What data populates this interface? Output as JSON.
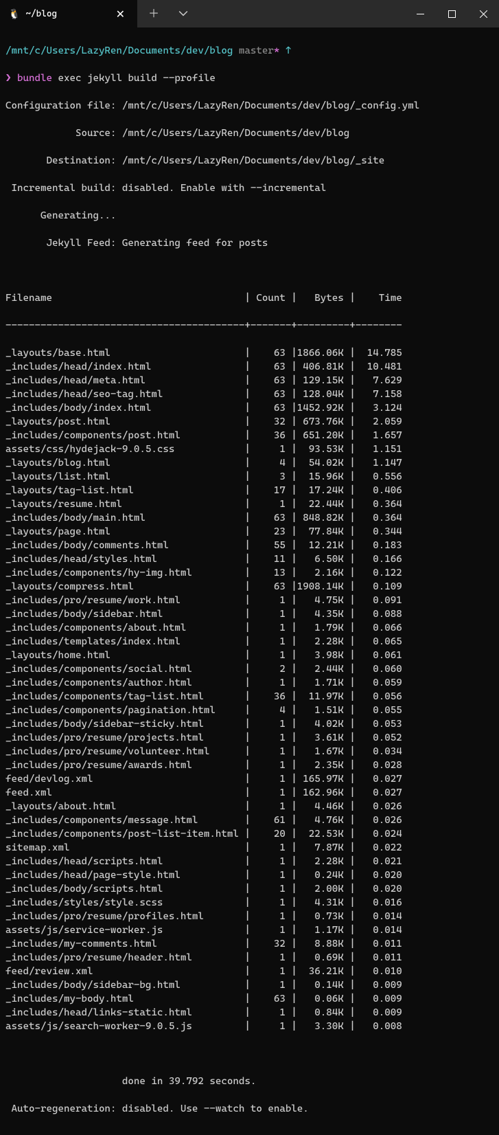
{
  "tab": {
    "title": "~/blog",
    "icon": "🐧"
  },
  "prompt": {
    "path": "/mnt/c/Users/LazyRen/Documents/dev/blog",
    "branch": "master",
    "dirty": "*",
    "ahead": "↑",
    "symbol": "❯",
    "command": "bundle",
    "args": "exec jekyll build --profile"
  },
  "output": {
    "config_line": "Configuration file: /mnt/c/Users/LazyRen/Documents/dev/blog/_config.yml",
    "source_line": "            Source: /mnt/c/Users/LazyRen/Documents/dev/blog",
    "dest_line": "       Destination: /mnt/c/Users/LazyRen/Documents/dev/blog/_site",
    "incremental_line": " Incremental build: disabled. Enable with --incremental",
    "generating_line": "      Generating...",
    "feed_line": "       Jekyll Feed: Generating feed for posts",
    "done_line": "                    done in 39.792 seconds.",
    "autoregen_line": " Auto-regeneration: disabled. Use --watch to enable."
  },
  "table": {
    "header": {
      "filename": "Filename",
      "count": "Count",
      "bytes": "Bytes",
      "time": "Time"
    },
    "rows": [
      {
        "filename": "_layouts/base.html",
        "count": "63",
        "bytes": "1866.06K",
        "time": "14.785"
      },
      {
        "filename": "_includes/head/index.html",
        "count": "63",
        "bytes": "406.81K",
        "time": "10.481"
      },
      {
        "filename": "_includes/head/meta.html",
        "count": "63",
        "bytes": "129.15K",
        "time": "7.629"
      },
      {
        "filename": "_includes/head/seo-tag.html",
        "count": "63",
        "bytes": "128.04K",
        "time": "7.158"
      },
      {
        "filename": "_includes/body/index.html",
        "count": "63",
        "bytes": "1452.92K",
        "time": "3.124"
      },
      {
        "filename": "_layouts/post.html",
        "count": "32",
        "bytes": "673.76K",
        "time": "2.059"
      },
      {
        "filename": "_includes/components/post.html",
        "count": "36",
        "bytes": "651.20K",
        "time": "1.657"
      },
      {
        "filename": "assets/css/hydejack-9.0.5.css",
        "count": "1",
        "bytes": "93.53K",
        "time": "1.151"
      },
      {
        "filename": "_layouts/blog.html",
        "count": "4",
        "bytes": "54.02K",
        "time": "1.147"
      },
      {
        "filename": "_layouts/list.html",
        "count": "3",
        "bytes": "15.96K",
        "time": "0.556"
      },
      {
        "filename": "_layouts/tag-list.html",
        "count": "17",
        "bytes": "17.24K",
        "time": "0.406"
      },
      {
        "filename": "_layouts/resume.html",
        "count": "1",
        "bytes": "22.44K",
        "time": "0.364"
      },
      {
        "filename": "_includes/body/main.html",
        "count": "63",
        "bytes": "848.82K",
        "time": "0.364"
      },
      {
        "filename": "_layouts/page.html",
        "count": "23",
        "bytes": "77.84K",
        "time": "0.344"
      },
      {
        "filename": "_includes/body/comments.html",
        "count": "55",
        "bytes": "12.21K",
        "time": "0.183"
      },
      {
        "filename": "_includes/head/styles.html",
        "count": "11",
        "bytes": "6.50K",
        "time": "0.166"
      },
      {
        "filename": "_includes/components/hy-img.html",
        "count": "13",
        "bytes": "2.16K",
        "time": "0.122"
      },
      {
        "filename": "_layouts/compress.html",
        "count": "63",
        "bytes": "1908.14K",
        "time": "0.109"
      },
      {
        "filename": "_includes/pro/resume/work.html",
        "count": "1",
        "bytes": "4.75K",
        "time": "0.091"
      },
      {
        "filename": "_includes/body/sidebar.html",
        "count": "1",
        "bytes": "4.35K",
        "time": "0.088"
      },
      {
        "filename": "_includes/components/about.html",
        "count": "1",
        "bytes": "1.79K",
        "time": "0.066"
      },
      {
        "filename": "_includes/templates/index.html",
        "count": "1",
        "bytes": "2.28K",
        "time": "0.065"
      },
      {
        "filename": "_layouts/home.html",
        "count": "1",
        "bytes": "3.98K",
        "time": "0.061"
      },
      {
        "filename": "_includes/components/social.html",
        "count": "2",
        "bytes": "2.44K",
        "time": "0.060"
      },
      {
        "filename": "_includes/components/author.html",
        "count": "1",
        "bytes": "1.71K",
        "time": "0.059"
      },
      {
        "filename": "_includes/components/tag-list.html",
        "count": "36",
        "bytes": "11.97K",
        "time": "0.056"
      },
      {
        "filename": "_includes/components/pagination.html",
        "count": "4",
        "bytes": "1.51K",
        "time": "0.055"
      },
      {
        "filename": "_includes/body/sidebar-sticky.html",
        "count": "1",
        "bytes": "4.02K",
        "time": "0.053"
      },
      {
        "filename": "_includes/pro/resume/projects.html",
        "count": "1",
        "bytes": "3.61K",
        "time": "0.052"
      },
      {
        "filename": "_includes/pro/resume/volunteer.html",
        "count": "1",
        "bytes": "1.67K",
        "time": "0.034"
      },
      {
        "filename": "_includes/pro/resume/awards.html",
        "count": "1",
        "bytes": "2.35K",
        "time": "0.028"
      },
      {
        "filename": "feed/devlog.xml",
        "count": "1",
        "bytes": "165.97K",
        "time": "0.027"
      },
      {
        "filename": "feed.xml",
        "count": "1",
        "bytes": "162.96K",
        "time": "0.027"
      },
      {
        "filename": "_layouts/about.html",
        "count": "1",
        "bytes": "4.46K",
        "time": "0.026"
      },
      {
        "filename": "_includes/components/message.html",
        "count": "61",
        "bytes": "4.76K",
        "time": "0.026"
      },
      {
        "filename": "_includes/components/post-list-item.html",
        "count": "20",
        "bytes": "22.53K",
        "time": "0.024"
      },
      {
        "filename": "sitemap.xml",
        "count": "1",
        "bytes": "7.87K",
        "time": "0.022"
      },
      {
        "filename": "_includes/head/scripts.html",
        "count": "1",
        "bytes": "2.28K",
        "time": "0.021"
      },
      {
        "filename": "_includes/head/page-style.html",
        "count": "1",
        "bytes": "0.24K",
        "time": "0.020"
      },
      {
        "filename": "_includes/body/scripts.html",
        "count": "1",
        "bytes": "2.00K",
        "time": "0.020"
      },
      {
        "filename": "_includes/styles/style.scss",
        "count": "1",
        "bytes": "4.31K",
        "time": "0.016"
      },
      {
        "filename": "_includes/pro/resume/profiles.html",
        "count": "1",
        "bytes": "0.73K",
        "time": "0.014"
      },
      {
        "filename": "assets/js/service-worker.js",
        "count": "1",
        "bytes": "1.17K",
        "time": "0.014"
      },
      {
        "filename": "_includes/my-comments.html",
        "count": "32",
        "bytes": "8.88K",
        "time": "0.011"
      },
      {
        "filename": "_includes/pro/resume/header.html",
        "count": "1",
        "bytes": "0.69K",
        "time": "0.011"
      },
      {
        "filename": "feed/review.xml",
        "count": "1",
        "bytes": "36.21K",
        "time": "0.010"
      },
      {
        "filename": "_includes/body/sidebar-bg.html",
        "count": "1",
        "bytes": "0.14K",
        "time": "0.009"
      },
      {
        "filename": "_includes/my-body.html",
        "count": "63",
        "bytes": "0.06K",
        "time": "0.009"
      },
      {
        "filename": "_includes/head/links-static.html",
        "count": "1",
        "bytes": "0.84K",
        "time": "0.009"
      },
      {
        "filename": "assets/js/search-worker-9.0.5.js",
        "count": "1",
        "bytes": "3.30K",
        "time": "0.008"
      }
    ]
  }
}
